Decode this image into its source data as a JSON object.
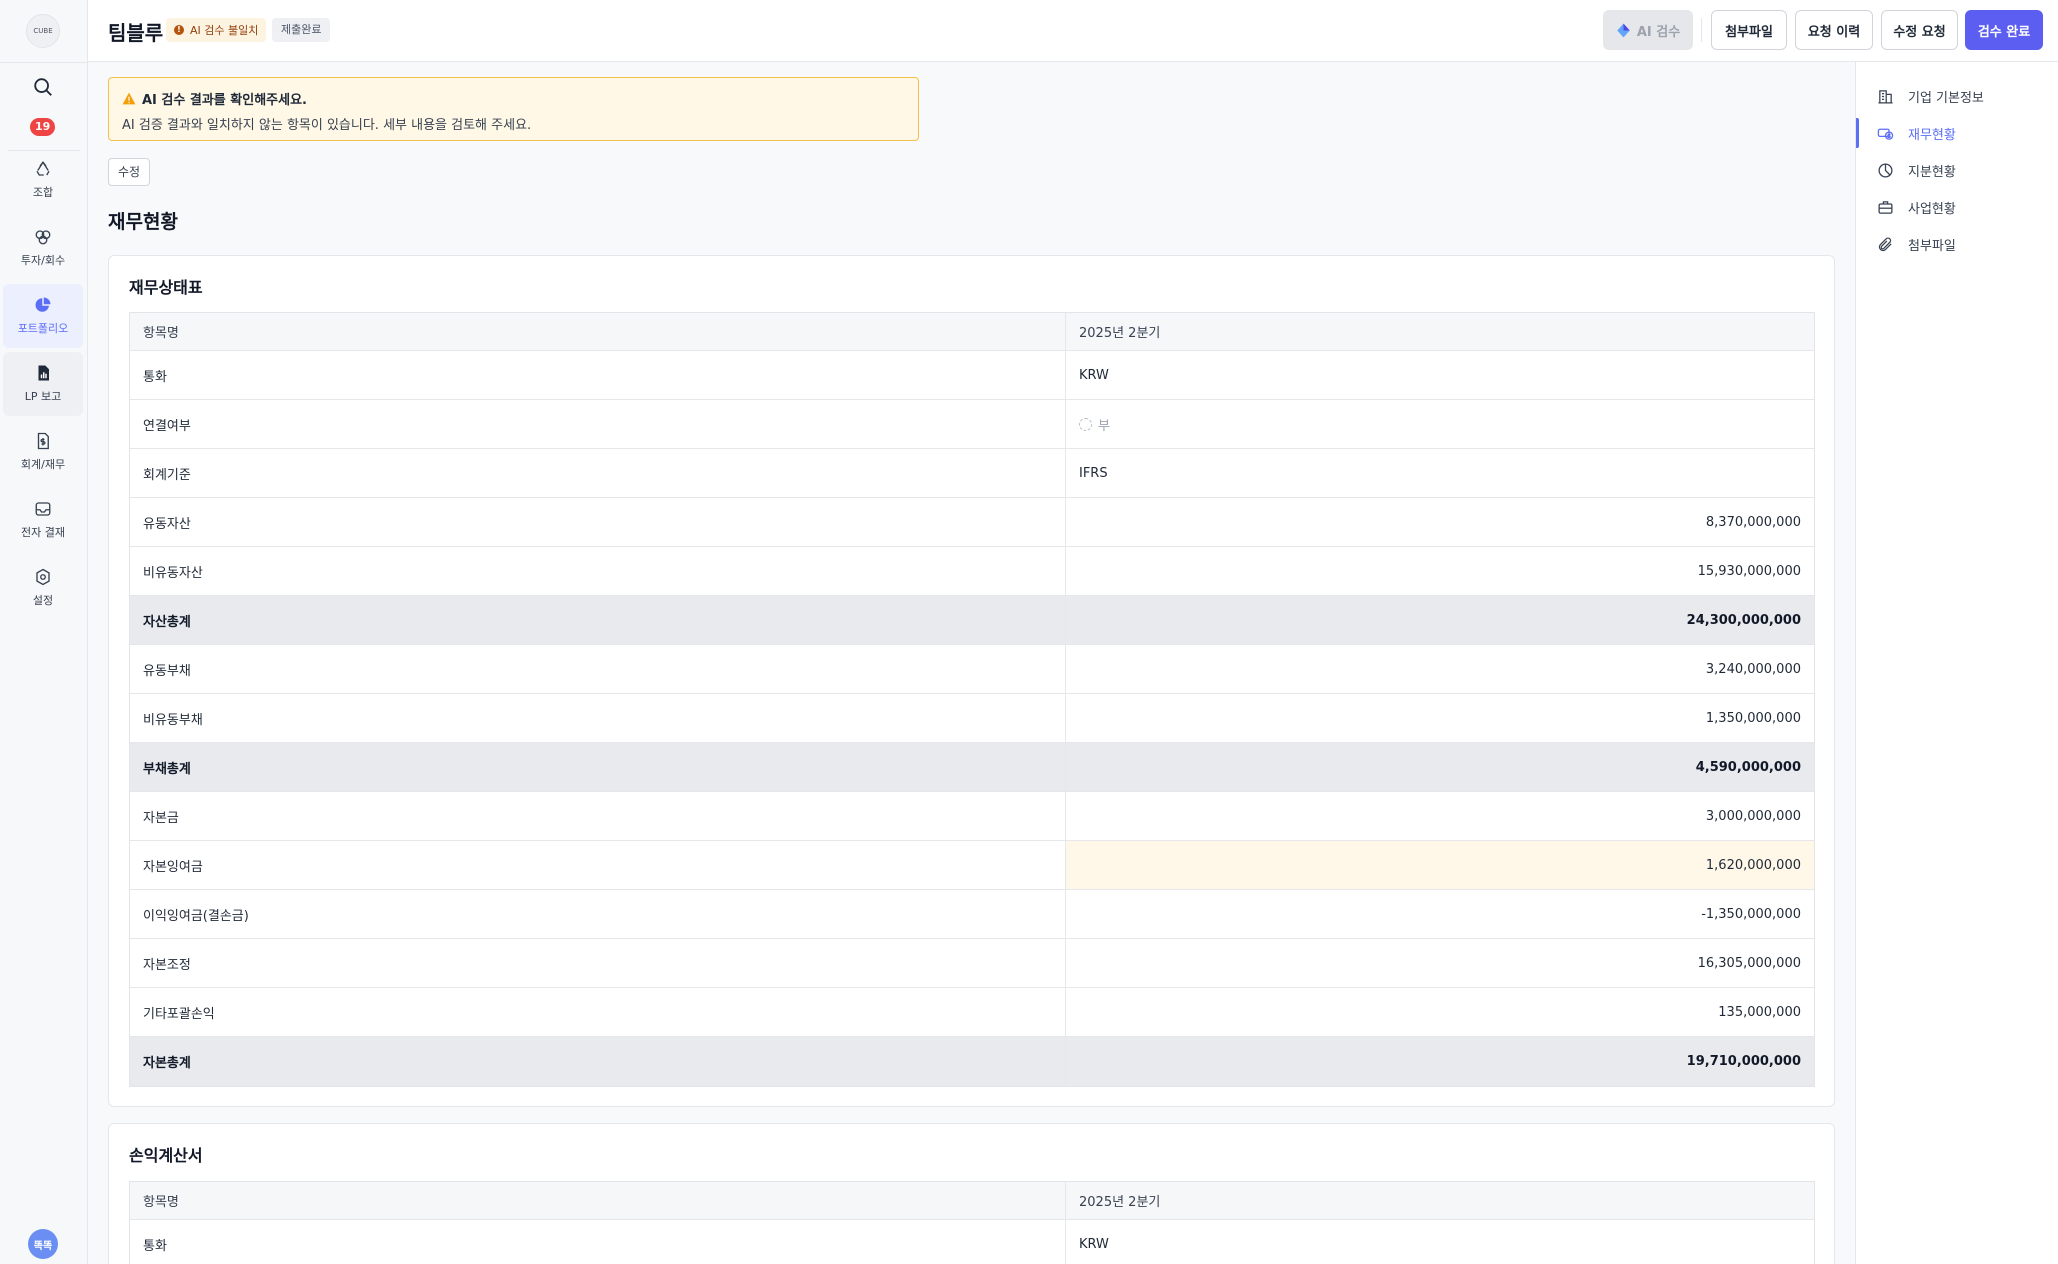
{
  "nav": {
    "logo_text": "CUBE",
    "badge_count": "19",
    "items": [
      {
        "label": "조합",
        "icon": "recycle-icon"
      },
      {
        "label": "투자/회수",
        "icon": "rings-icon"
      },
      {
        "label": "포트폴리오",
        "icon": "pie-chart-icon"
      },
      {
        "label": "LP 보고",
        "icon": "report-icon"
      },
      {
        "label": "회계/재무",
        "icon": "dollar-doc-icon"
      },
      {
        "label": "전자 결재",
        "icon": "inbox-icon"
      },
      {
        "label": "설정",
        "icon": "gear-icon"
      }
    ],
    "avatar_text": "똑똑"
  },
  "header": {
    "company": "팀블루",
    "warn_tag": "AI 검수 불일치",
    "status_tag": "제출완료",
    "buttons": {
      "ai": "AI 검수",
      "attach": "첨부파일",
      "history": "요청 이력",
      "revise": "수정 요청",
      "complete": "검수 완료"
    }
  },
  "alert": {
    "title": "AI 검수 결과를 확인해주세요.",
    "body": "AI 검증 결과와 일치하지 않는 항목이 있습니다. 세부 내용을 검토해 주세요."
  },
  "edit_label": "수정",
  "section_title": "재무현황",
  "balance_sheet": {
    "title": "재무상태표",
    "head": {
      "name": "항목명",
      "period": "2025년 2분기"
    },
    "rows": [
      {
        "name": "통화",
        "value": "KRW"
      },
      {
        "name": "연결여부",
        "value": "부"
      },
      {
        "name": "회계기준",
        "value": "IFRS"
      },
      {
        "name": "유동자산",
        "value": "8,370,000,000"
      },
      {
        "name": "비유동자산",
        "value": "15,930,000,000"
      },
      {
        "name": "자산총계",
        "value": "24,300,000,000"
      },
      {
        "name": "유동부채",
        "value": "3,240,000,000"
      },
      {
        "name": "비유동부채",
        "value": "1,350,000,000"
      },
      {
        "name": "부채총계",
        "value": "4,590,000,000"
      },
      {
        "name": "자본금",
        "value": "3,000,000,000"
      },
      {
        "name": "자본잉여금",
        "value": "1,620,000,000"
      },
      {
        "name": "이익잉여금(결손금)",
        "value": "-1,350,000,000"
      },
      {
        "name": "자본조정",
        "value": "16,305,000,000"
      },
      {
        "name": "기타포괄손익",
        "value": "135,000,000"
      },
      {
        "name": "자본총계",
        "value": "19,710,000,000"
      }
    ]
  },
  "income_statement": {
    "title": "손익계산서",
    "head": {
      "name": "항목명",
      "period": "2025년 2분기"
    },
    "rows": [
      {
        "name": "통화",
        "value": "KRW"
      }
    ]
  },
  "toc": {
    "items": [
      {
        "label": "기업 기본정보",
        "icon": "building-icon"
      },
      {
        "label": "재무현황",
        "icon": "money-icon"
      },
      {
        "label": "지분현황",
        "icon": "pie-icon"
      },
      {
        "label": "사업현황",
        "icon": "briefcase-icon"
      },
      {
        "label": "첨부파일",
        "icon": "paperclip-icon"
      }
    ]
  },
  "colors": {
    "accent": "#5b5ef0",
    "warn_bg": "#fff8e6",
    "warn_border": "#f2c14e",
    "badge": "#ef4444"
  }
}
